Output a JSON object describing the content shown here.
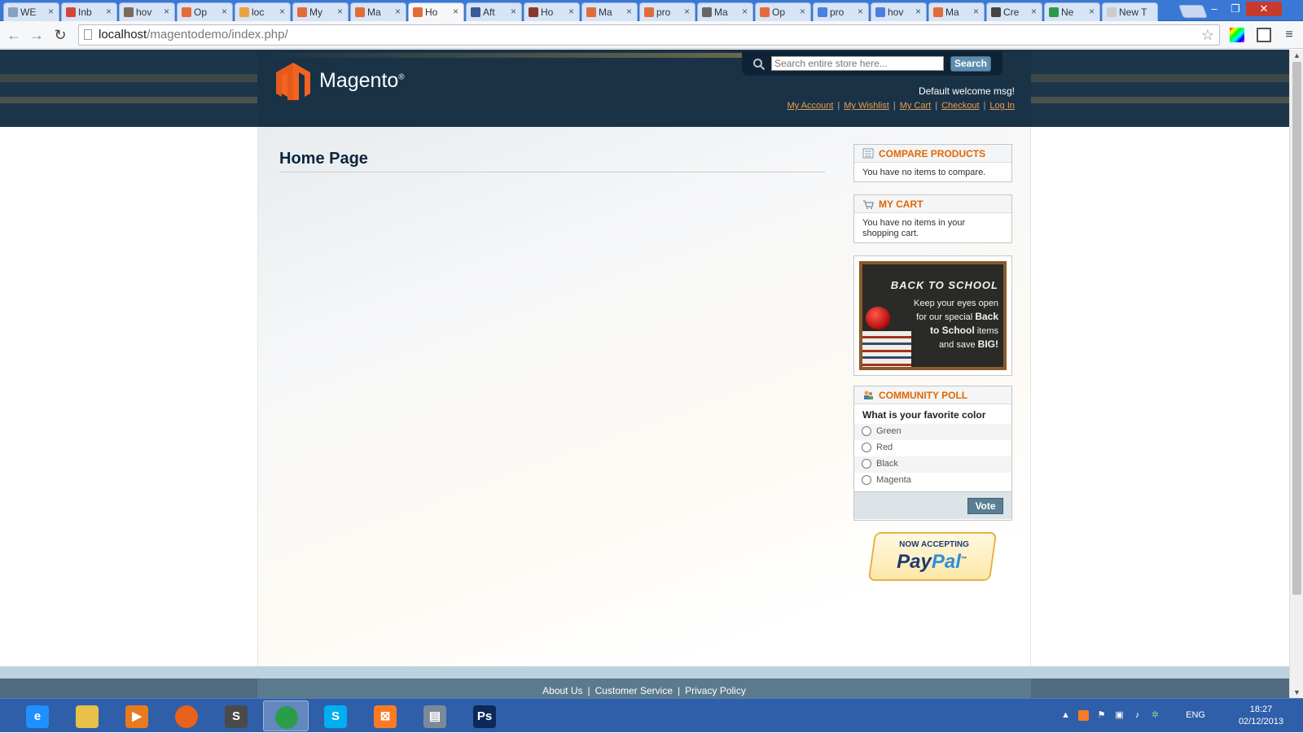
{
  "browser": {
    "tabs": [
      {
        "label": "WE",
        "icon": "doc-icon",
        "color": "#8aa0c0"
      },
      {
        "label": "Inb",
        "icon": "gmail-icon",
        "color": "#d44638"
      },
      {
        "label": "hov",
        "icon": "stack-icon",
        "color": "#7a6a5a"
      },
      {
        "label": "Op",
        "icon": "magento-icon",
        "color": "#e36b3a"
      },
      {
        "label": "loc",
        "icon": "pma-icon",
        "color": "#e8a33a"
      },
      {
        "label": "My",
        "icon": "magento-icon",
        "color": "#e36b3a"
      },
      {
        "label": "Ma",
        "icon": "magento-icon",
        "color": "#e36b3a"
      },
      {
        "label": "Ho",
        "icon": "magento-icon",
        "color": "#e36b3a"
      },
      {
        "label": "Aft",
        "icon": "facebook-icon",
        "color": "#3b5998"
      },
      {
        "label": "Ho",
        "icon": "image-icon",
        "color": "#8a3a2a"
      },
      {
        "label": "Ma",
        "icon": "magento-icon",
        "color": "#e36b3a"
      },
      {
        "label": "pro",
        "icon": "magento-icon",
        "color": "#e36b3a"
      },
      {
        "label": "Ma",
        "icon": "at-icon",
        "color": "#666666"
      },
      {
        "label": "Op",
        "icon": "magento-icon",
        "color": "#e36b3a"
      },
      {
        "label": "pro",
        "icon": "google-icon",
        "color": "#4a7ee0"
      },
      {
        "label": "hov",
        "icon": "google-icon",
        "color": "#4a7ee0"
      },
      {
        "label": "Ma",
        "icon": "magento-icon",
        "color": "#e36b3a"
      },
      {
        "label": "Cre",
        "icon": "fp-icon",
        "color": "#444444"
      },
      {
        "label": "Ne",
        "icon": "sheet-icon",
        "color": "#2a9a4a"
      },
      {
        "label": "New T",
        "icon": "blank-icon",
        "color": "#cccccc"
      }
    ],
    "active_tab_index": 7,
    "url_host": "localhost",
    "url_path": "/magentodemo/index.php/"
  },
  "store": {
    "logo_text": "Magento",
    "logo_reg": "®",
    "search_placeholder": "Search entire store here...",
    "search_button": "Search",
    "welcome": "Default welcome msg!",
    "links": [
      "My Account",
      "My Wishlist",
      "My Cart",
      "Checkout",
      "Log In"
    ],
    "page_title": "Home Page",
    "compare": {
      "title": "COMPARE PRODUCTS",
      "text": "You have no items to compare."
    },
    "cart": {
      "title": "MY CART",
      "text": "You have no items in your shopping cart."
    },
    "banner": {
      "title": "BACK TO SCHOOL",
      "line1": "Keep your eyes open",
      "line2": "for our special",
      "bold1": "Back",
      "bold2": "to School",
      "line3": "items",
      "line4": "and save",
      "bold3": "BIG!"
    },
    "poll": {
      "title": "COMMUNITY POLL",
      "question": "What is your favorite color",
      "options": [
        "Green",
        "Red",
        "Black",
        "Magenta"
      ],
      "vote": "Vote"
    },
    "paypal": {
      "line1": "NOW ACCEPTING",
      "pay": "Pay",
      "pal": "Pal",
      "tm": "™"
    },
    "footer_links": [
      "About Us",
      "Customer Service",
      "Privacy Policy"
    ]
  },
  "taskbar": {
    "apps": [
      {
        "name": "internet-explorer-icon",
        "glyph": "e",
        "color": "#1e90ff"
      },
      {
        "name": "file-explorer-icon",
        "glyph": "",
        "color": "#e7c14a"
      },
      {
        "name": "media-player-icon",
        "glyph": "▶",
        "color": "#e87a20"
      },
      {
        "name": "firefox-icon",
        "glyph": "",
        "color": "#e8611a"
      },
      {
        "name": "sublime-icon",
        "glyph": "S",
        "color": "#4a4a4a"
      },
      {
        "name": "chrome-icon",
        "glyph": "",
        "color": "#2a9d4a"
      },
      {
        "name": "skype-icon",
        "glyph": "S",
        "color": "#00aff0"
      },
      {
        "name": "xampp-icon",
        "glyph": "⊠",
        "color": "#fb7a24"
      },
      {
        "name": "file-manager-icon",
        "glyph": "▤",
        "color": "#7a8a9a"
      },
      {
        "name": "photoshop-icon",
        "glyph": "Ps",
        "color": "#0b2a5a"
      }
    ],
    "language": "ENG",
    "time": "18:27",
    "date": "02/12/2013"
  }
}
